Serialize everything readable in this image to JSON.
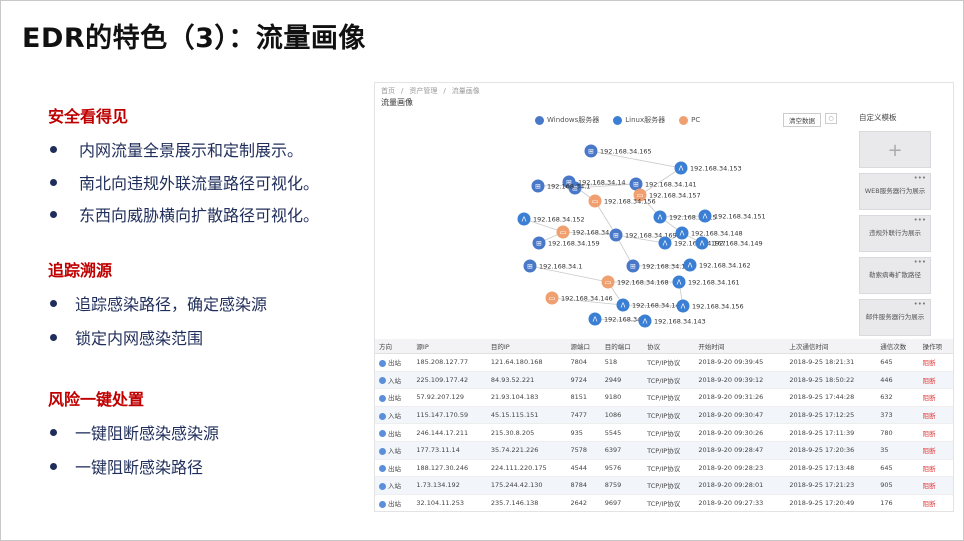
{
  "title": "EDR的特色（3）：流量画像",
  "sections": [
    {
      "heading": "安全看得见",
      "bullets": [
        "内网流量全景展示和定制展示。",
        "南北向违规外联流量路径可视化。",
        "东西向威胁横向扩散路径可视化。"
      ]
    },
    {
      "heading": "追踪溯源",
      "bullets": [
        "追踪感染路径，确定感染源",
        "锁定内网感染范围"
      ]
    },
    {
      "heading": "风险一键处置",
      "bullets": [
        "一键阻断感染感染源",
        "一键阻断感染路径"
      ]
    }
  ],
  "screenshot": {
    "breadcrumb": [
      "首页",
      "/",
      "资产管理",
      "/",
      "流量画像"
    ],
    "page_title": "流量画像",
    "legend": {
      "windows": "Windows服务器",
      "linux": "Linux服务器",
      "pc": "PC"
    },
    "clear_button": "清空数据",
    "custom_template_title": "自定义模板",
    "templates": [
      "+",
      "WEB服务器行为展示",
      "违规外联行为展示",
      "勒索病毒扩散路径",
      "邮件服务器行为展示"
    ],
    "more_symbol": "•••",
    "colors": {
      "windows": "#4a78c8",
      "linux": "#3b7fd4",
      "pc": "#f0a070",
      "block": "#e03a3a"
    },
    "nodes": [
      {
        "t": "w",
        "label": "192.168.34.165"
      },
      {
        "t": "w",
        "label": ""
      },
      {
        "t": "l",
        "label": "192.168.34.153"
      },
      {
        "t": "w",
        "label": "192.168.34.141"
      },
      {
        "t": "w",
        "label": "192.168.34.14"
      },
      {
        "t": "w",
        "label": "192.168.34.1"
      },
      {
        "t": "p",
        "label": "192.168.34.157"
      },
      {
        "t": "p",
        "label": "192.168.34.156"
      },
      {
        "t": "l",
        "label": "192.168.34.152"
      },
      {
        "t": "l",
        "label": "192.168.34.15"
      },
      {
        "t": "l",
        "label": "192.168.34.151"
      },
      {
        "t": "p",
        "label": "192.168.34."
      },
      {
        "t": "w",
        "label": "192.168.34.169"
      },
      {
        "t": "l",
        "label": "192.168.34.148"
      },
      {
        "t": "w",
        "label": "192.168.34.159"
      },
      {
        "t": "l",
        "label": "192.168.34.167"
      },
      {
        "t": "l",
        "label": "192.168.34.149"
      },
      {
        "t": "w",
        "label": "192.168.34.1"
      },
      {
        "t": "w",
        "label": "192.168.34.160"
      },
      {
        "t": "l",
        "label": "192.168.34.162"
      },
      {
        "t": "p",
        "label": "192.168.34.168"
      },
      {
        "t": "l",
        "label": "192.168.34.161"
      },
      {
        "t": "p",
        "label": "192.168.34.146"
      },
      {
        "t": "l",
        "label": "192.168.34.14"
      },
      {
        "t": "l",
        "label": "192.168.34.156"
      },
      {
        "t": "l",
        "label": "192.168.34."
      },
      {
        "t": "l",
        "label": "192.168.34.143"
      }
    ],
    "table": {
      "headers": [
        "方向",
        "源IP",
        "目的IP",
        "源端口",
        "目的端口",
        "协议",
        "开始时间",
        "上次通信时间",
        "通信次数",
        "操作项"
      ],
      "rows": [
        [
          "出站",
          "185.208.127.77",
          "121.64.180.168",
          "7804",
          "518",
          "TCP/IP协议",
          "2018-9-20  09:39:45",
          "2018-9-25  18:21:31",
          "645",
          "阻断"
        ],
        [
          "入站",
          "225.109.177.42",
          "84.93.52.221",
          "9724",
          "2949",
          "TCP/IP协议",
          "2018-9-20  09:39:12",
          "2018-9-25  18:50:22",
          "446",
          "阻断"
        ],
        [
          "出站",
          "57.92.207.129",
          "21.93.104.183",
          "8151",
          "9180",
          "TCP/IP协议",
          "2018-9-20  09:31:26",
          "2018-9-25  17:44:28",
          "632",
          "阻断"
        ],
        [
          "入站",
          "115.147.170.59",
          "45.15.115.151",
          "7477",
          "1086",
          "TCP/IP协议",
          "2018-9-20  09:30:47",
          "2018-9-25  17:12:25",
          "373",
          "阻断"
        ],
        [
          "出站",
          "246.144.17.211",
          "215.30.8.205",
          "935",
          "5545",
          "TCP/IP协议",
          "2018-9-20  09:30:26",
          "2018-9-25  17:11:39",
          "780",
          "阻断"
        ],
        [
          "入站",
          "177.73.11.14",
          "35.74.221.226",
          "7578",
          "6397",
          "TCP/IP协议",
          "2018-9-20  09:28:47",
          "2018-9-25  17:20:36",
          "35",
          "阻断"
        ],
        [
          "出站",
          "188.127.30.246",
          "224.111.220.175",
          "4544",
          "9576",
          "TCP/IP协议",
          "2018-9-20  09:28:23",
          "2018-9-25  17:13:48",
          "645",
          "阻断"
        ],
        [
          "入站",
          "1.73.134.192",
          "175.244.42.130",
          "8784",
          "8759",
          "TCP/IP协议",
          "2018-9-20  09:28:01",
          "2018-9-25  17:21:23",
          "905",
          "阻断"
        ],
        [
          "出站",
          "32.104.11.253",
          "235.7.146.138",
          "2642",
          "9697",
          "TCP/IP协议",
          "2018-9-20  09:27:33",
          "2018-9-25  17:20:49",
          "176",
          "阻断"
        ]
      ]
    }
  }
}
